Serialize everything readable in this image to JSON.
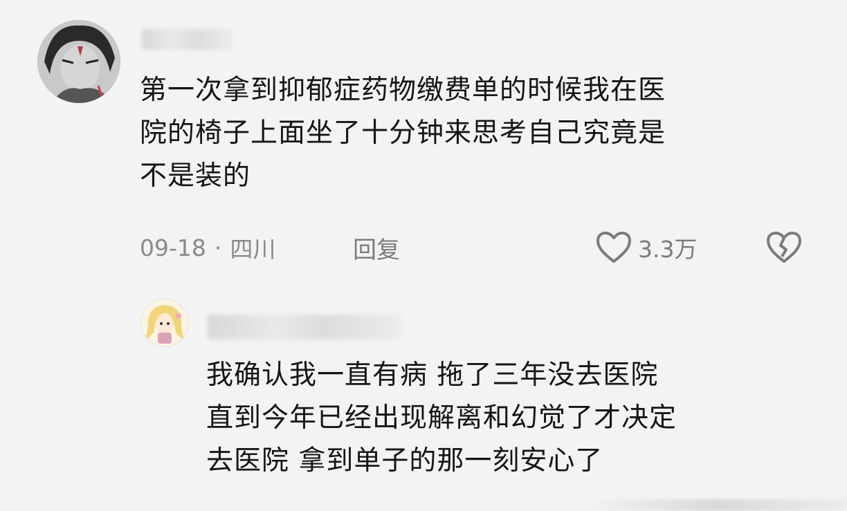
{
  "comment": {
    "text_lines": [
      "第一次拿到抑郁症药物缴费单的时候我在医",
      "院的椅子上面坐了十分钟来思考自己究竟是",
      "不是装的"
    ],
    "date": "09-18",
    "separator": "·",
    "location": "四川",
    "reply_label": "回复",
    "like_count": "3.3万",
    "like_icon": "heart-outline-icon",
    "dislike_icon": "broken-heart-icon"
  },
  "reply": {
    "text_lines": [
      "我确认我一直有病 拖了三年没去医院",
      "直到今年已经出现解离和幻觉了才决定",
      "去医院 拿到单子的那一刻安心了"
    ]
  },
  "colors": {
    "text": "#151515",
    "meta": "#8a8a8a",
    "icon": "#7b7b7b",
    "background": "#f3f3f3"
  }
}
